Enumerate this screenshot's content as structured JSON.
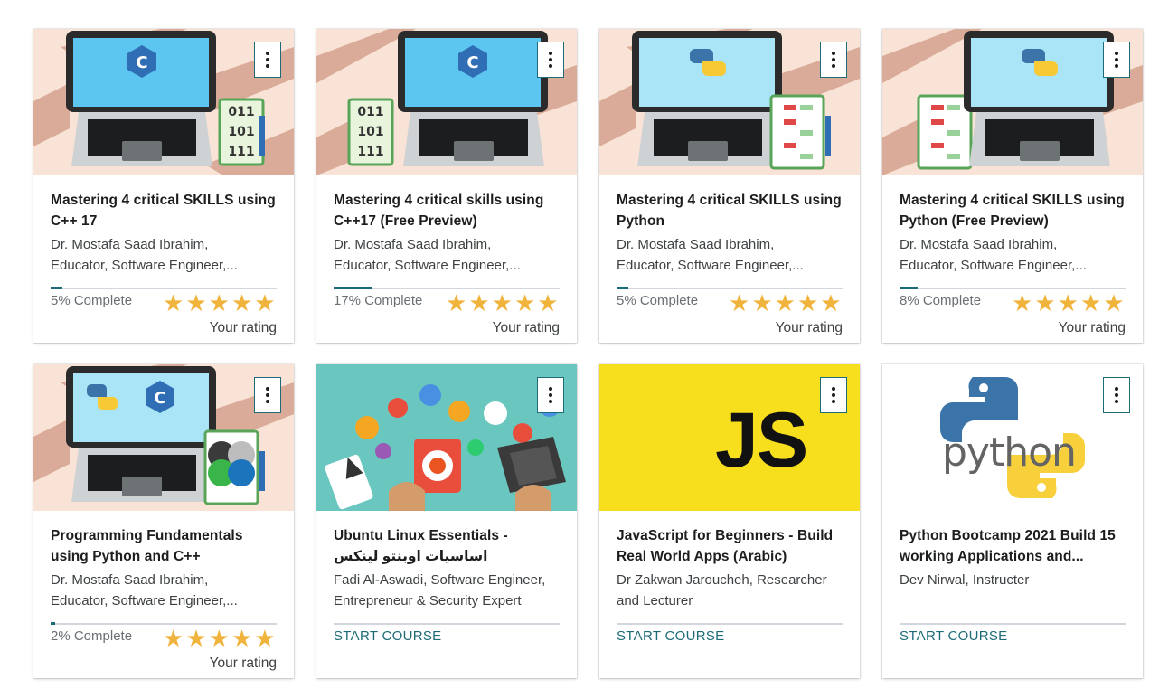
{
  "colors": {
    "accent": "#1c6b77",
    "star": "#f0b43c",
    "js_yellow": "#f7df1e"
  },
  "cards": [
    {
      "thumbnail": "laptop-cpp-binary",
      "title": "Mastering 4 critical SKILLS using C++ 17",
      "author_line1": "Dr. Mostafa Saad Ibrahim,",
      "author_line2": "Educator, Software Engineer,...",
      "progress": 0.05,
      "complete_label": "5% Complete",
      "rating_label": "Your rating"
    },
    {
      "thumbnail": "laptop-cpp-binary-left",
      "title": "Mastering 4 critical skills using C++17 (Free Preview)",
      "author_line1": "Dr. Mostafa Saad Ibrahim,",
      "author_line2": "Educator, Software Engineer,...",
      "progress": 0.17,
      "complete_label": "17% Complete",
      "rating_label": "Your rating"
    },
    {
      "thumbnail": "laptop-python-flowchart",
      "title": "Mastering 4 critical SKILLS using Python",
      "author_line1": "Dr. Mostafa Saad Ibrahim,",
      "author_line2": "Educator, Software Engineer,...",
      "progress": 0.05,
      "complete_label": "5% Complete",
      "rating_label": "Your rating"
    },
    {
      "thumbnail": "laptop-python-flowchart-left",
      "title": "Mastering 4 critical SKILLS using Python (Free Preview)",
      "author_line1": "Dr. Mostafa Saad Ibrahim,",
      "author_line2": "Educator, Software Engineer,...",
      "progress": 0.08,
      "complete_label": "8% Complete",
      "rating_label": "Your rating"
    },
    {
      "thumbnail": "laptop-python-cpp-venn",
      "title": "Programming Fundamentals using Python and C++",
      "author_line1": "Dr. Mostafa Saad Ibrahim,",
      "author_line2": "Educator, Software Engineer,...",
      "progress": 0.02,
      "complete_label": "2% Complete",
      "rating_label": "Your rating"
    },
    {
      "thumbnail": "ubuntu-illustration",
      "title": "Ubuntu Linux Essentials - اساسيات اوبنتو لينكس",
      "author_line1": "Fadi Al-Aswadi, Software Engineer,",
      "author_line2": "Entrepreneur & Security Expert",
      "start_label": "START COURSE"
    },
    {
      "thumbnail": "javascript-logo",
      "title": "JavaScript for Beginners - Build Real World Apps (Arabic)",
      "author_line1": "Dr Zakwan Jaroucheh, Researcher",
      "author_line2": "and Lecturer",
      "js_text": "JS",
      "start_label": "START COURSE"
    },
    {
      "thumbnail": "python-logo",
      "title": "Python Bootcamp 2021 Build 15 working Applications and...",
      "author_line1": "Dev Nirwal, Instructer",
      "author_line2": "",
      "python_text": "python",
      "start_label": "START COURSE"
    }
  ]
}
